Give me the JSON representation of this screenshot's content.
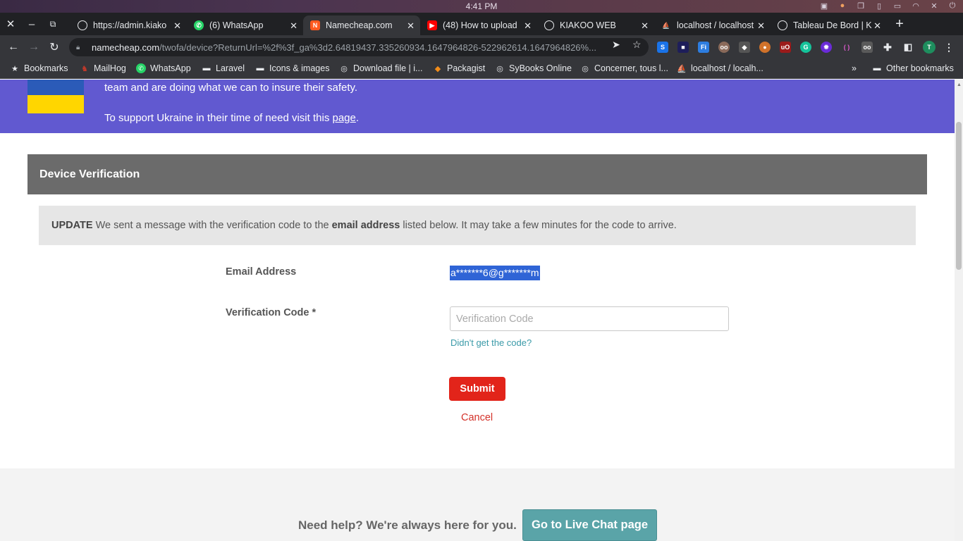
{
  "os": {
    "time": "4:41 PM"
  },
  "tabs": [
    {
      "title": "https://admin.kiako",
      "favicon": "globe-icon",
      "color": "#9aa0a6"
    },
    {
      "title": "(6) WhatsApp",
      "favicon": "whatsapp-icon",
      "color": "#25d366"
    },
    {
      "title": "Namecheap.com",
      "favicon": "namecheap-icon",
      "color": "#ff5a1f",
      "active": true
    },
    {
      "title": "(48) How to upload",
      "favicon": "youtube-icon",
      "color": "#ff0000"
    },
    {
      "title": "KIAKOO WEB",
      "favicon": "globe-icon",
      "color": "#9aa0a6"
    },
    {
      "title": "localhost / localhost",
      "favicon": "phpmyadmin-icon",
      "color": "#f29111"
    },
    {
      "title": "Tableau De Bord | K",
      "favicon": "globe-icon",
      "color": "#9aa0a6"
    }
  ],
  "address": {
    "host": "namecheap.com",
    "path": "/twofa/device?ReturnUrl=%2f%3f_ga%3d2.64819437.335260934.1647964826-522962614.1647964826%..."
  },
  "extensions": [
    "S",
    "■",
    "Fi",
    "oo",
    "◆",
    "●",
    "uO",
    "G",
    "✹",
    "( )",
    "oo"
  ],
  "profile_initial": "T",
  "bookmarks": [
    {
      "label": "Bookmarks",
      "icon": "star-icon"
    },
    {
      "label": "MailHog",
      "icon": "mailhog-icon"
    },
    {
      "label": "WhatsApp",
      "icon": "whatsapp-icon"
    },
    {
      "label": "Laravel",
      "icon": "folder-icon"
    },
    {
      "label": "Icons & images",
      "icon": "folder-icon"
    },
    {
      "label": "Download file | i...",
      "icon": "globe-icon"
    },
    {
      "label": "Packagist",
      "icon": "packagist-icon"
    },
    {
      "label": "SyBooks Online",
      "icon": "globe-icon"
    },
    {
      "label": "Concerner, tous l...",
      "icon": "globe-icon"
    },
    {
      "label": "localhost / localh...",
      "icon": "phpmyadmin-icon"
    }
  ],
  "bookmarks_more": "»",
  "other_bookmarks": "Other bookmarks",
  "banner": {
    "line1": "team and are doing what we can to insure their safety.",
    "line2_prefix": "To support Ukraine in their time of need visit this ",
    "line2_link": "page",
    "line2_suffix": "."
  },
  "panel": {
    "title": "Device Verification"
  },
  "notice": {
    "strong1": "UPDATE",
    "text1": " We sent a message with the verification code to the ",
    "strong2": "email address",
    "text2": " listed below. It may take a few minutes for the code to arrive."
  },
  "form": {
    "email_label": "Email Address",
    "email_value": "a*******6@g*******m",
    "code_label": "Verification Code *",
    "code_placeholder": "Verification Code",
    "resend_link": "Didn't get the code?",
    "submit": "Submit",
    "cancel": "Cancel"
  },
  "footer": {
    "help_text": "Need help? We're always here for you.",
    "chat_button": "Go to Live Chat page"
  }
}
